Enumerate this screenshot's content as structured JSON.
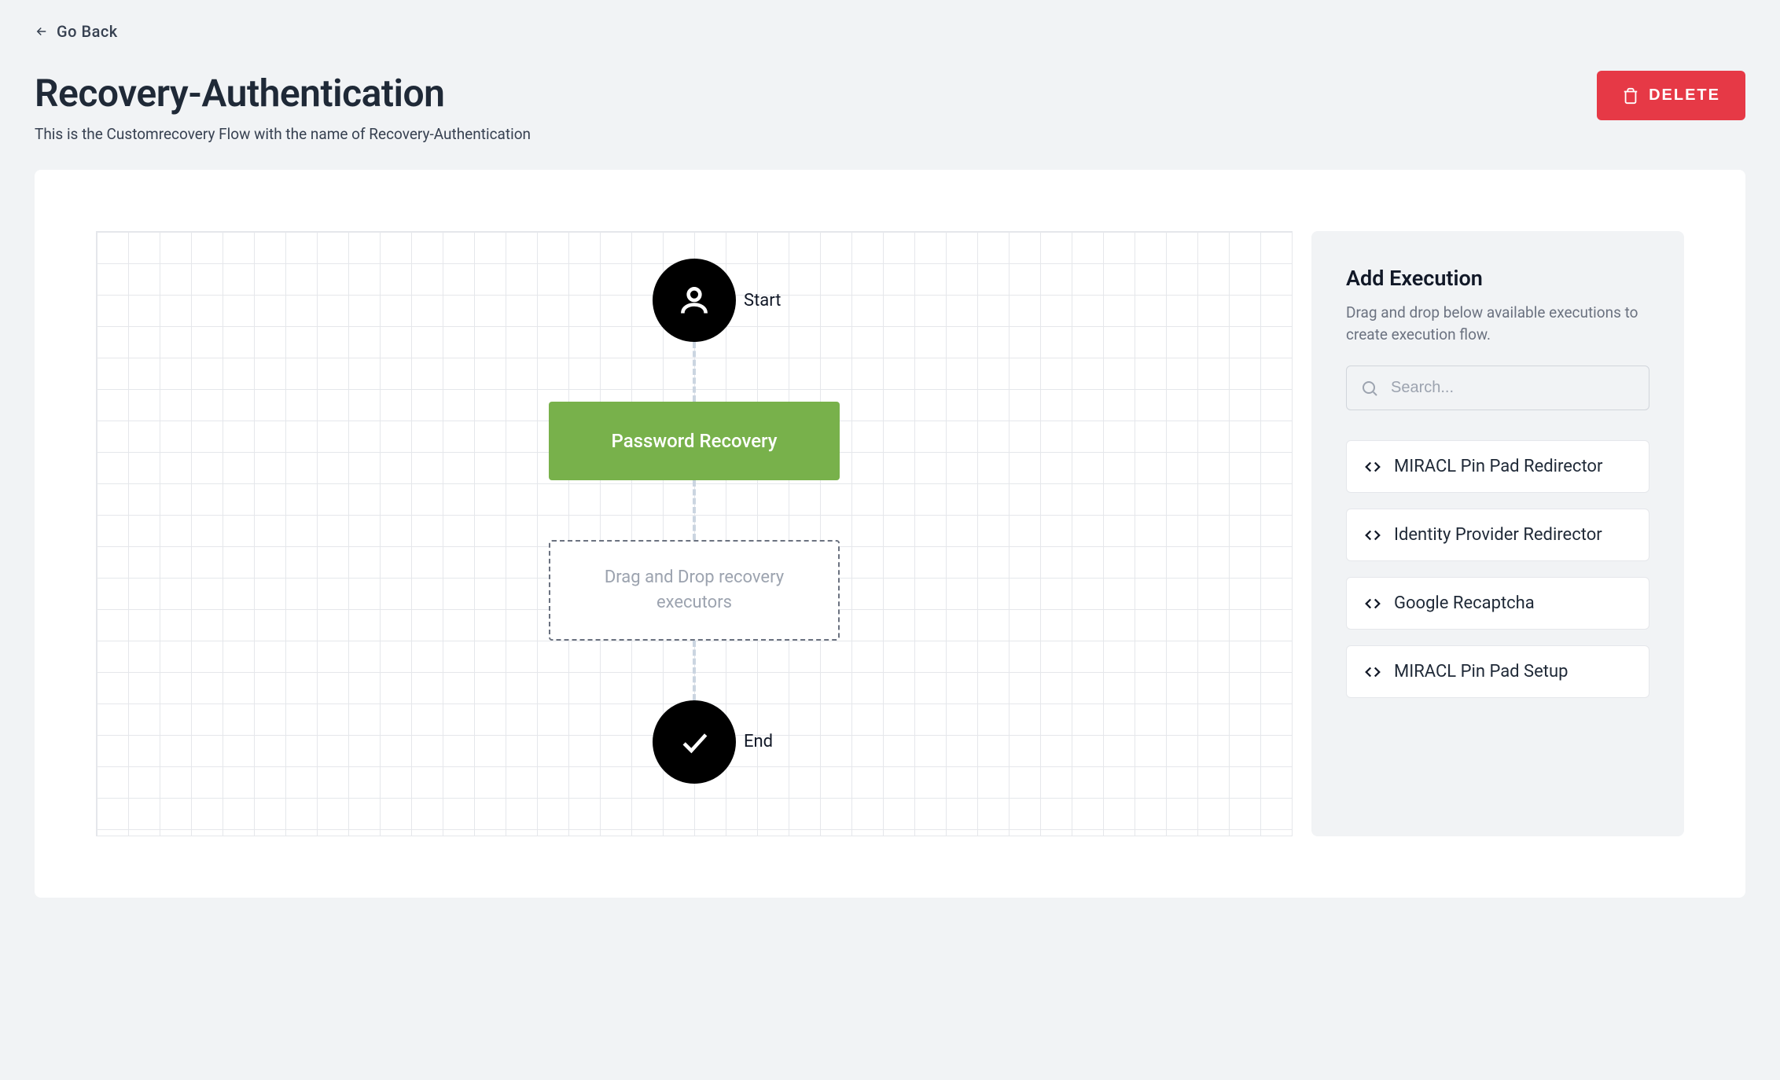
{
  "nav": {
    "go_back": "Go Back"
  },
  "header": {
    "title": "Recovery-Authentication",
    "subtitle": "This is the Customrecovery Flow with the name of Recovery-Authentication",
    "delete_label": "DELETE"
  },
  "flow": {
    "start_label": "Start",
    "action_label": "Password Recovery",
    "drop_hint": "Drag and Drop recovery executors",
    "end_label": "End"
  },
  "sidebar": {
    "title": "Add Execution",
    "description": "Drag and drop below available executions to create execution flow.",
    "search_placeholder": "Search...",
    "items": [
      {
        "label": "MIRACL Pin Pad Redirector"
      },
      {
        "label": "Identity Provider Redirector"
      },
      {
        "label": "Google Recaptcha"
      },
      {
        "label": "MIRACL Pin Pad Setup"
      }
    ]
  }
}
